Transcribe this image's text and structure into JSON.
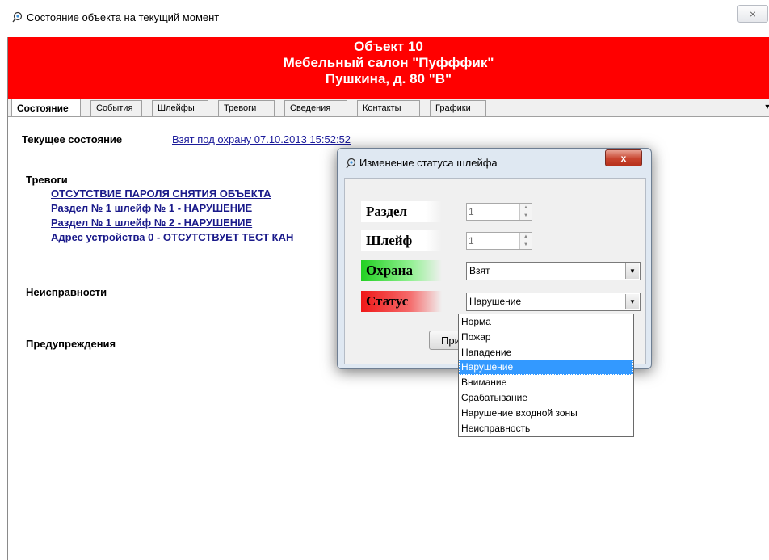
{
  "window": {
    "title": "Состояние объекта на текущий момент",
    "close_glyph": "⨯"
  },
  "banner": {
    "line1": "Объект   10",
    "line2": "Мебельный салон \"Пуфффик\"",
    "line3": "Пушкина, д. 80 \"В\"",
    "color": "#ff0000"
  },
  "tabs": [
    {
      "label": "Состояние",
      "active": true
    },
    {
      "label": "События"
    },
    {
      "label": "Шлейфы"
    },
    {
      "label": "Тревоги"
    },
    {
      "label": "Сведения"
    },
    {
      "label": "Контакты"
    },
    {
      "label": "Графики"
    }
  ],
  "main": {
    "current_state_label": "Текущее состояние",
    "current_state_value": "Взят под охрану 07.10.2013 15:52:52",
    "alarms_label": "Тревоги",
    "alarms": [
      "ОТСУТСТВИЕ ПАРОЛЯ СНЯТИЯ ОБЪЕКТА",
      "Раздел № 1 шлейф № 1 - НАРУШЕНИЕ",
      "Раздел № 1 шлейф № 2 - НАРУШЕНИЕ",
      "Адрес устройства 0 - ОТСУТСТВУЕТ ТЕСТ КАН"
    ],
    "faults_label": "Неисправности",
    "warnings_label": "Предупреждения"
  },
  "dialog": {
    "title": "Изменение статуса шлейфа",
    "close_glyph": "x",
    "section_label": "Раздел",
    "section_value": "1",
    "loop_label": "Шлейф",
    "loop_value": "1",
    "guard_label": "Охрана",
    "guard_value": "Взят",
    "status_label": "Статус",
    "status_value": "Нарушение",
    "apply_button": "При"
  },
  "status_options": [
    "Норма",
    "Пожар",
    "Нападение",
    "Нарушение",
    "Внимание",
    "Срабатывание",
    "Нарушение входной зоны",
    "Неисправность"
  ],
  "selected_status_index": 3,
  "colors": {
    "banner": "#ff0000",
    "guard_label": "#22d022",
    "status_label": "#f01818",
    "selection": "#3399ff",
    "link": "#1a1a9a"
  }
}
